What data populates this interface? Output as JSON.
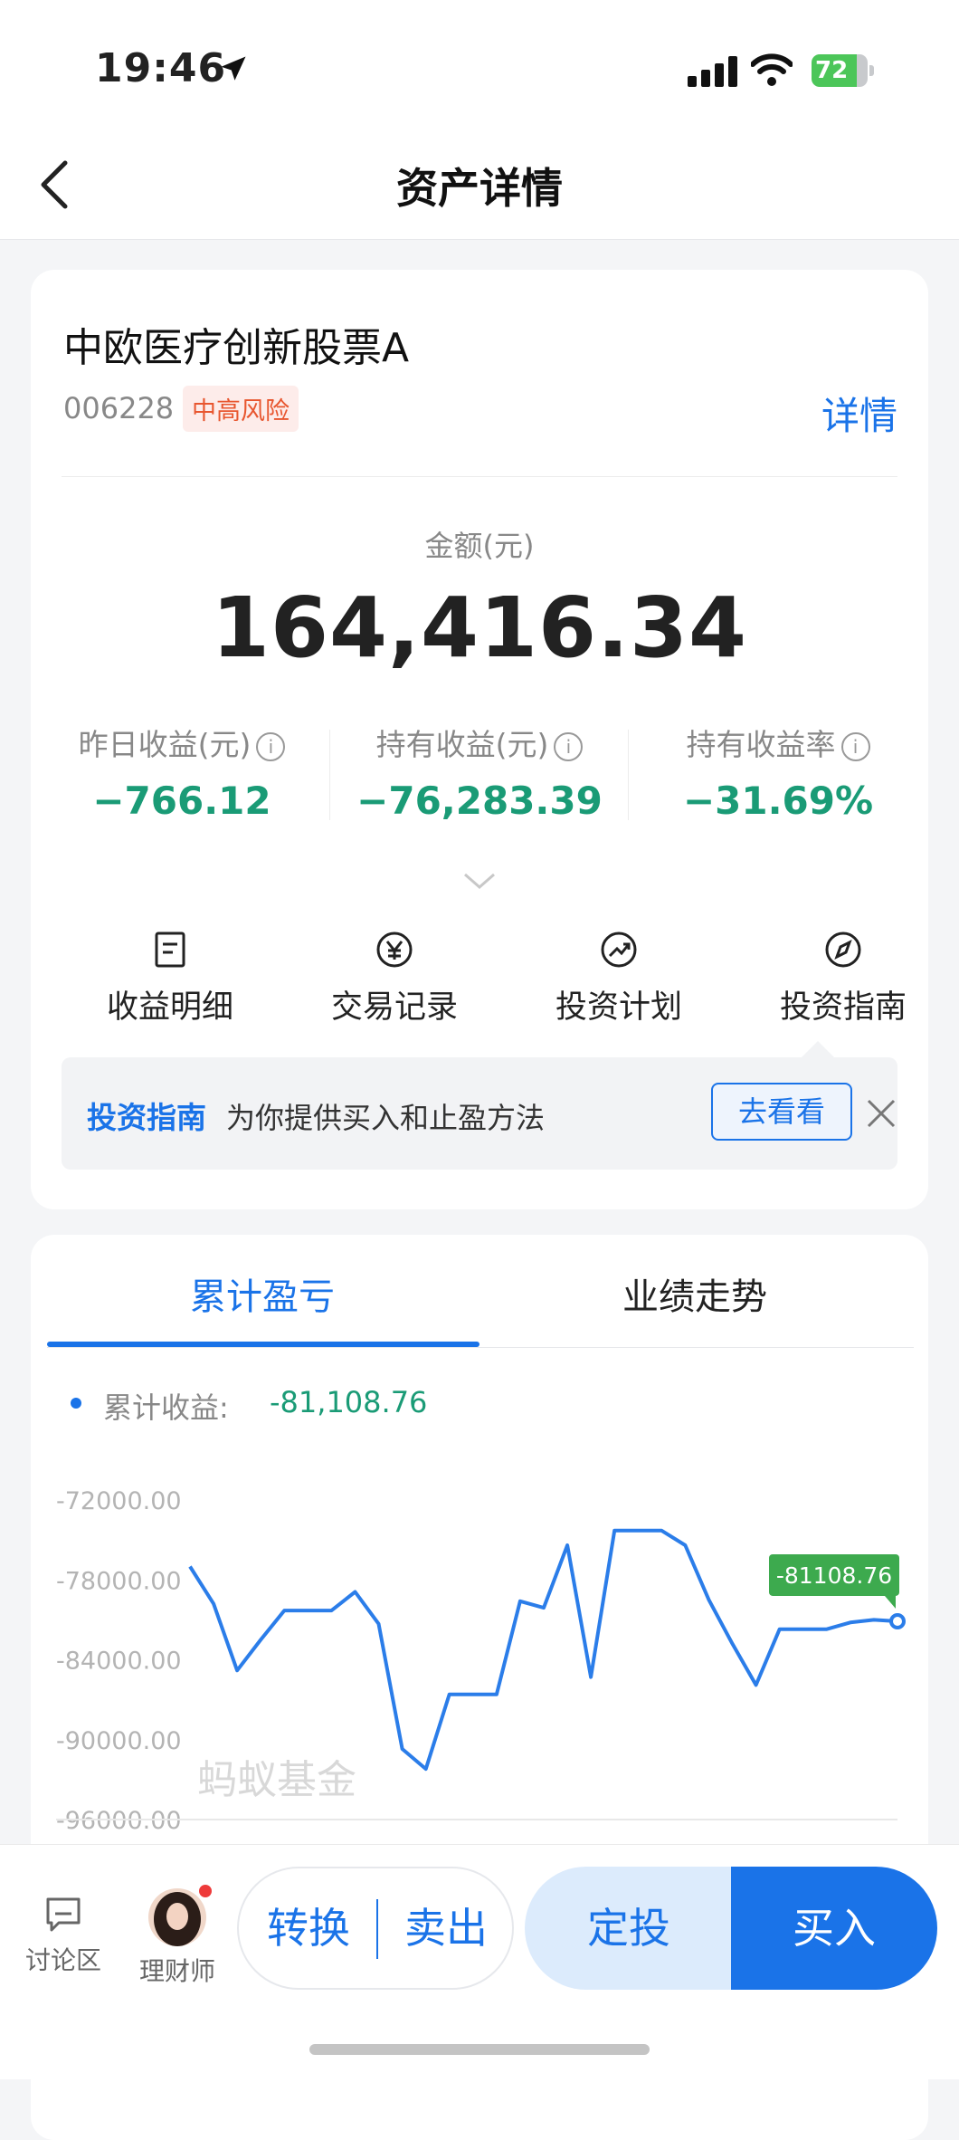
{
  "status_bar": {
    "time": "19:46",
    "battery": "72"
  },
  "nav": {
    "title": "资产详情"
  },
  "fund": {
    "name": "中欧医疗创新股票A",
    "code": "006228",
    "risk": "中高风险",
    "detail_link": "详情",
    "amount_label": "金额(元)",
    "amount": "164,416.34"
  },
  "stats": [
    {
      "label": "昨日收益(元)",
      "value": "−766.12"
    },
    {
      "label": "持有收益(元)",
      "value": "−76,283.39"
    },
    {
      "label": "持有收益率",
      "value": "−31.69%"
    }
  ],
  "quick_actions": [
    {
      "label": "收益明细",
      "icon": "document-icon"
    },
    {
      "label": "交易记录",
      "icon": "yen-icon"
    },
    {
      "label": "投资计划",
      "icon": "trend-icon"
    },
    {
      "label": "投资指南",
      "icon": "compass-icon"
    }
  ],
  "guide": {
    "logo": "投资指南",
    "text": "为你提供买入和止盈方法",
    "button": "去看看"
  },
  "chart_tabs": [
    "累计盈亏",
    "业绩走势"
  ],
  "legend": {
    "name": "累计收益:",
    "value": "-81,108.76"
  },
  "watermark": "蚂蚁基金",
  "chart_data": {
    "type": "line",
    "series": [
      {
        "name": "累计收益",
        "values": [
          -77000,
          -79800,
          -84800,
          -82500,
          -80300,
          -80300,
          -80300,
          -78900,
          -81300,
          -90700,
          -92200,
          -86600,
          -86600,
          -86600,
          -79600,
          -80100,
          -75400,
          -85300,
          -74300,
          -74300,
          -74300,
          -75400,
          -79500,
          -82800,
          -85900,
          -81700,
          -81700,
          -81700,
          -81200,
          -81000,
          -81108.76
        ]
      }
    ],
    "yticks": [
      "-72000.00",
      "-78000.00",
      "-84000.00",
      "-90000.00",
      "-96000.00"
    ],
    "ylim": [
      -96000,
      -72000
    ],
    "last_value_label": "-81108.76",
    "color": "#2b7de9"
  },
  "bottom_bar": {
    "discuss": "讨论区",
    "advisor": "理财师",
    "convert": "转换",
    "sell": "卖出",
    "auto_invest": "定投",
    "buy": "买入"
  }
}
